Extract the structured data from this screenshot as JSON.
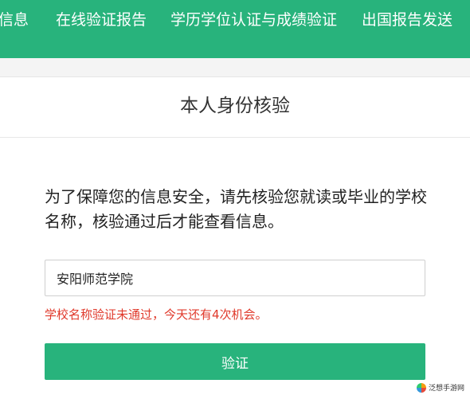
{
  "nav": {
    "items": [
      {
        "label": "信息"
      },
      {
        "label": "在线验证报告"
      },
      {
        "label": "学历学位认证与成绩验证"
      },
      {
        "label": "出国报告发送"
      }
    ]
  },
  "card": {
    "title": "本人身份核验",
    "instructions": "为了保障您的信息安全，请先核验您就读或毕业的学校名称，核验通过后才能查看信息。",
    "school_input_value": "安阳师范学院",
    "error": "学校名称验证未通过，今天还有4次机会。",
    "verify_label": "验证"
  },
  "watermark": {
    "text": "泛想手游网"
  },
  "colors": {
    "brand_green": "#28b37c",
    "error_red": "#e0392b"
  }
}
